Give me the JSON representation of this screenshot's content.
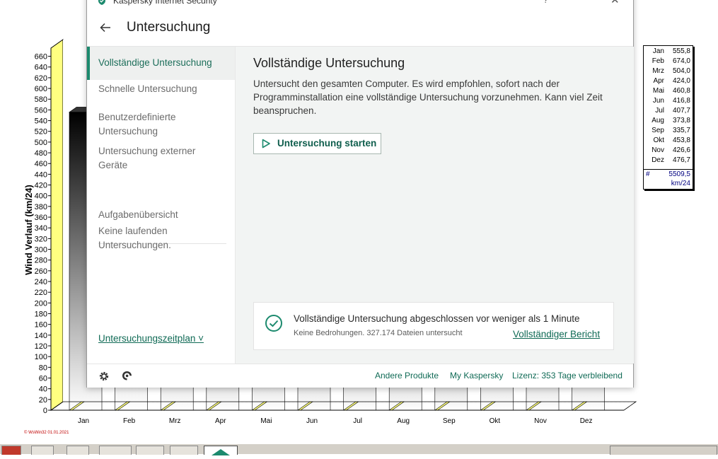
{
  "chart_window": {
    "ylabel": "Wind Verlauf  (km/24)",
    "footnote": "© WsWin32  01.01.2021",
    "legend_sum_hash": "#",
    "legend_sum_value": "5509,5",
    "legend_unit": "km/24",
    "colors": {
      "wall": "#ffff80",
      "floor_edge": "#000000",
      "bar_top": "#000000"
    }
  },
  "chart_data": {
    "type": "bar",
    "categories": [
      "Jan",
      "Feb",
      "Mrz",
      "Apr",
      "Mai",
      "Jun",
      "Jul",
      "Aug",
      "Sep",
      "Okt",
      "Nov",
      "Dez"
    ],
    "values": [
      555.8,
      674.0,
      504.0,
      424.0,
      460.8,
      416.8,
      407.7,
      373.8,
      335.7,
      453.8,
      426.6,
      476.7
    ],
    "value_labels": [
      "555,8",
      "674,0",
      "504,0",
      "424,0",
      "460,8",
      "416,8",
      "407,7",
      "373,8",
      "335,7",
      "453,8",
      "426,6",
      "476,7"
    ],
    "ylabel": "Wind Verlauf  (km/24)",
    "ylim": [
      0,
      670
    ],
    "yticks": [
      0,
      20,
      40,
      60,
      80,
      100,
      120,
      140,
      160,
      180,
      200,
      220,
      240,
      260,
      280,
      300,
      320,
      340,
      360,
      380,
      400,
      420,
      440,
      460,
      480,
      500,
      520,
      540,
      560,
      580,
      600,
      620,
      640,
      660
    ],
    "grid": true
  },
  "kaspersky": {
    "app_title": "Kaspersky Internet Security",
    "menu_glyph": "?",
    "close_glyph": "✕",
    "page_title": "Untersuchung",
    "sidebar": {
      "items": [
        {
          "label": "Vollständige Untersuchung"
        },
        {
          "label": "Schnelle Untersuchung"
        },
        {
          "label": "Benutzerdefinierte Untersuchung"
        },
        {
          "label": "Untersuchung externer Geräte"
        },
        {
          "label": "Aufgabenübersicht"
        }
      ],
      "tasks_status": "Keine laufenden Untersuchungen.",
      "schedule_link": "Untersuchungszeitplan ˅"
    },
    "main": {
      "title": "Vollständige Untersuchung",
      "description": "Untersucht den gesamten Computer. Es wird empfohlen, sofort nach der Programminstallation eine vollständige Untersuchung vorzunehmen. Kann viel Zeit beanspruchen.",
      "start_button": "Untersuchung starten",
      "status_message": "Vollständige Untersuchung abgeschlossen vor weniger als 1 Minute",
      "status_detail": "Keine Bedrohungen. 327.174 Dateien untersucht",
      "report_link": "Vollständiger Bericht"
    },
    "footer": {
      "other_products": "Andere Produkte",
      "my_kaspersky": "My Kaspersky",
      "license": "Lizenz: 353 Tage verbleibend"
    },
    "colors": {
      "accent": "#1c8a6e",
      "link": "#0f6a55"
    }
  }
}
